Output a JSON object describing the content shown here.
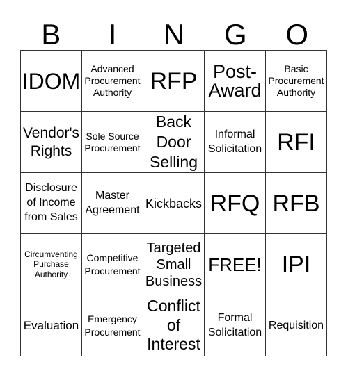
{
  "header": [
    "B",
    "I",
    "N",
    "G",
    "O"
  ],
  "cells": [
    [
      "IDOM",
      "Advanced Procurement Authority",
      "RFP",
      "Post-Award",
      "Basic Procurement Authority"
    ],
    [
      "Vendor's Rights",
      "Sole Source Procurement",
      "Back Door Selling",
      "Informal Solicitation",
      "RFI"
    ],
    [
      "Disclosure of Income from Sales",
      "Master Agreement",
      "Kickbacks",
      "RFQ",
      "RFB"
    ],
    [
      "Circumventing Purchase Authority",
      "Competitive Procurement",
      "Targeted Small Business",
      "FREE!",
      "IPI"
    ],
    [
      "Evaluation",
      "Emergency Procurement",
      "Conflict of Interest",
      "Formal Solicitation",
      "Requisition"
    ]
  ]
}
